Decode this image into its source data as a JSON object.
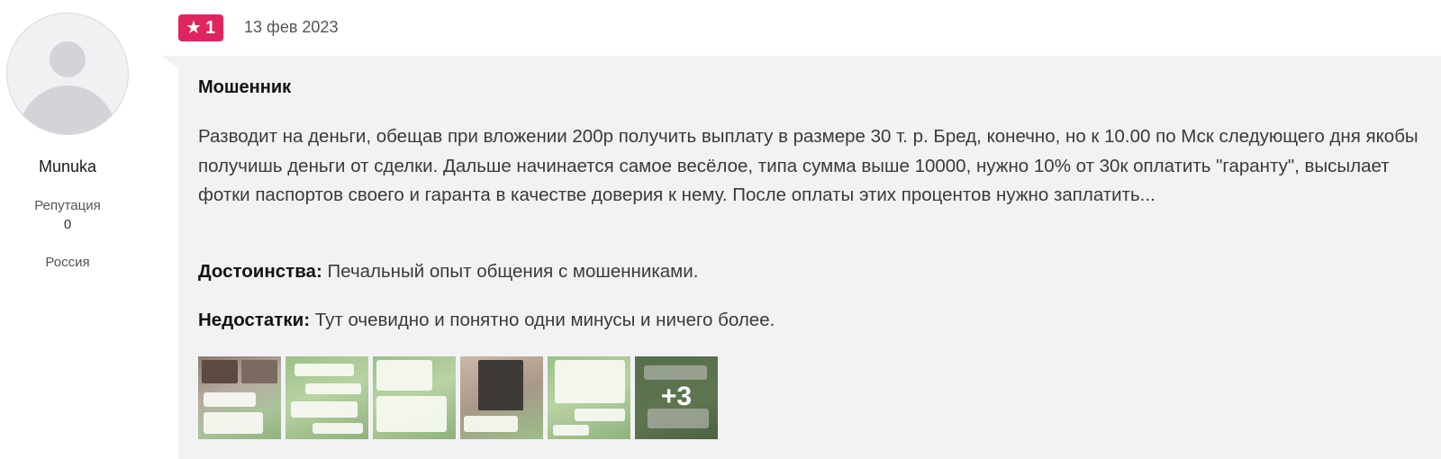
{
  "author": {
    "name": "Munuka",
    "reputation_label": "Репутация",
    "reputation_value": "0",
    "country": "Россия"
  },
  "review": {
    "rating": "1",
    "date": "13 фев 2023",
    "title": "Мошенник",
    "text": "Разводит на деньги, обещав при вложении 200р получить выплату в размере 30 т. р. Бред, конечно, но к 10.00 по Мск следующего дня якобы получишь деньги от сделки. Дальше начинается самое весёлое, типа сумма выше 10000, нужно 10% от 30к оплатить \"гаранту\", высылает фотки паспортов своего и гаранта в качестве доверия к нему. После оплаты этих процентов нужно заплатить...",
    "pros_label": "Достоинства:",
    "pros_text": "Печальный опыт общения с мошенниками.",
    "cons_label": "Недостатки:",
    "cons_text": "Тут очевидно и понятно одни минусы и ничего более.",
    "more_photos": "+3"
  },
  "colors": {
    "rating_badge": "#e0245e",
    "bubble_bg": "#f2f2f4",
    "chat_green": "#9bbf8a"
  },
  "icons": {
    "star": "star-icon",
    "avatar": "default-avatar-icon"
  }
}
